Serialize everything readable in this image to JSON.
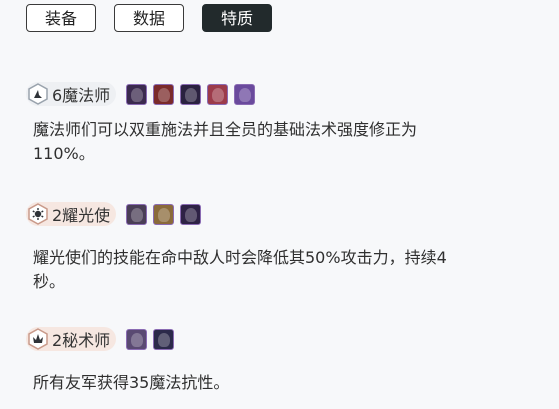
{
  "tabs": [
    {
      "label": "装备",
      "active": false
    },
    {
      "label": "数据",
      "active": false
    },
    {
      "label": "特质",
      "active": true
    }
  ],
  "traits": [
    {
      "name": "6魔法师",
      "icon": "sorcerer-icon",
      "tier": "silver",
      "description_lines": [
        "魔法师们可以双重施法并且全员的基础法术强度修正为",
        "110%。"
      ],
      "champion_colors": [
        "#3b2a4e",
        "#7a2a2a",
        "#2a2140",
        "#9c3b4a",
        "#6a4a9c"
      ]
    },
    {
      "name": "2耀光使",
      "icon": "radiant-icon",
      "tier": "bronze",
      "description_lines": [
        "耀光使们的技能在命中敌人时会降低其50%攻击力，持续4",
        "秒。"
      ],
      "champion_colors": [
        "#4a3e56",
        "#8a6a3a",
        "#2e2245"
      ]
    },
    {
      "name": "2秘术师",
      "icon": "mystic-icon",
      "tier": "bronze",
      "description_lines": [
        "所有友军获得35魔法抗性。"
      ],
      "champion_colors": [
        "#5a4a72",
        "#2c2a4a"
      ]
    }
  ]
}
